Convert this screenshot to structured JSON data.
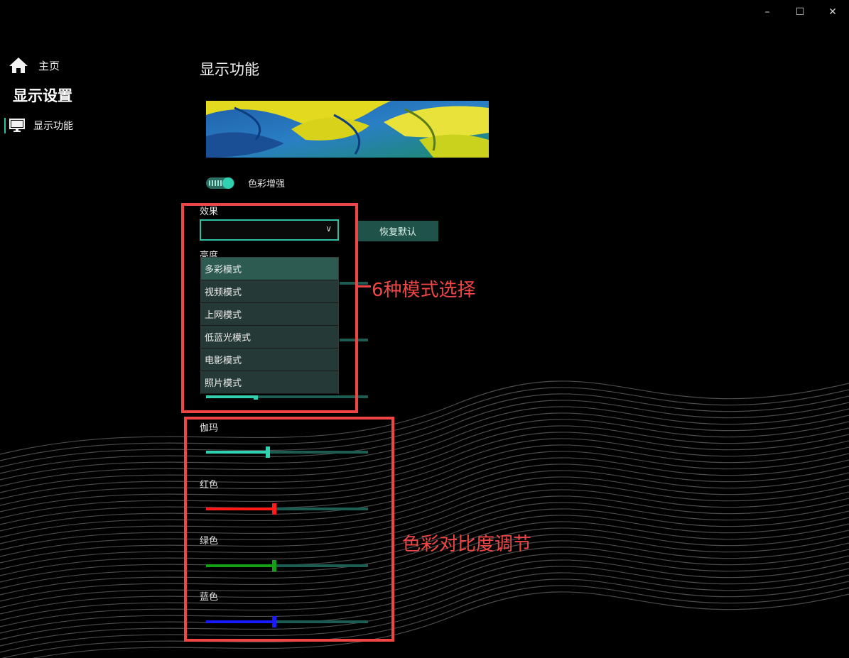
{
  "window": {
    "minimize_icon": "minimize-icon",
    "maximize_icon": "maximize-icon",
    "close_icon": "close-icon"
  },
  "sidebar": {
    "home_label": "主页",
    "section_title": "显示设置",
    "items": [
      {
        "label": "显示功能",
        "icon": "monitor-icon"
      }
    ]
  },
  "main": {
    "title": "显示功能",
    "color_enhance": {
      "label": "色彩增强",
      "on": true
    },
    "effect": {
      "label": "效果",
      "selected_value": "",
      "options": [
        "多彩模式",
        "视频模式",
        "上网模式",
        "低蓝光模式",
        "电影模式",
        "照片模式"
      ],
      "highlighted": "多彩模式"
    },
    "reset_label": "恢复默认",
    "brightness_label": "亮度",
    "sliders": [
      {
        "label": "伽玛",
        "value": 0.38,
        "color": "#2fd1b0"
      },
      {
        "label": "红色",
        "value": 0.42,
        "color": "#ff1a1a"
      },
      {
        "label": "绿色",
        "value": 0.42,
        "color": "#14a014"
      },
      {
        "label": "蓝色",
        "value": 0.42,
        "color": "#1a1aff"
      }
    ],
    "hidden_sliders": [
      {
        "value": 0.0
      },
      {
        "value": 0.0
      },
      {
        "value": 0.3
      }
    ]
  },
  "annotations": {
    "modes_note": "6种模式选择",
    "color_note": "色彩对比度调节",
    "color": "#f04545"
  }
}
